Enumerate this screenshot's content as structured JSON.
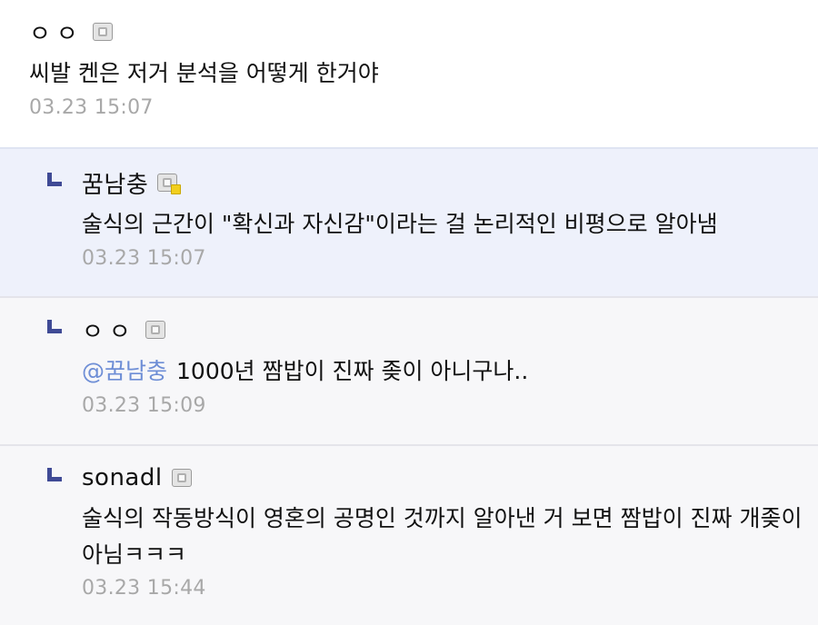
{
  "comments": [
    {
      "nickname": "ㅇㅇ",
      "text": "씨발 켄은 저거 분석을 어떻게 한거야",
      "time": "03.23 15:07",
      "is_reply": false
    },
    {
      "nickname": "꿈남충",
      "text": "술식의 근간이 \"확신과 자신감\"이라는 걸 논리적인 비평으로 알아냄",
      "time": "03.23 15:07",
      "is_reply": true,
      "highlighted": true
    },
    {
      "nickname": "ㅇㅇ",
      "mention": "@꿈남충",
      "text": "1000년 짬밥이 진짜 좆이 아니구나..",
      "time": "03.23 15:09",
      "is_reply": true
    },
    {
      "nickname": "sonadl",
      "text": "술식의 작동방식이 영혼의 공명인 것까지 알아낸 거 보면 짬밥이 진짜 개좆이 아님ㅋㅋㅋ",
      "time": "03.23 15:44",
      "is_reply": true
    }
  ],
  "colors": {
    "reply_mark": "#3f4a95",
    "highlight_bg": "#eef1fb",
    "reply_bg": "#f7f7f9",
    "mention": "#6e8ed6",
    "timestamp": "#a8a8a8"
  },
  "icons": {
    "reply": "reply-arrow-icon",
    "user_badge": "member-badge-icon"
  }
}
